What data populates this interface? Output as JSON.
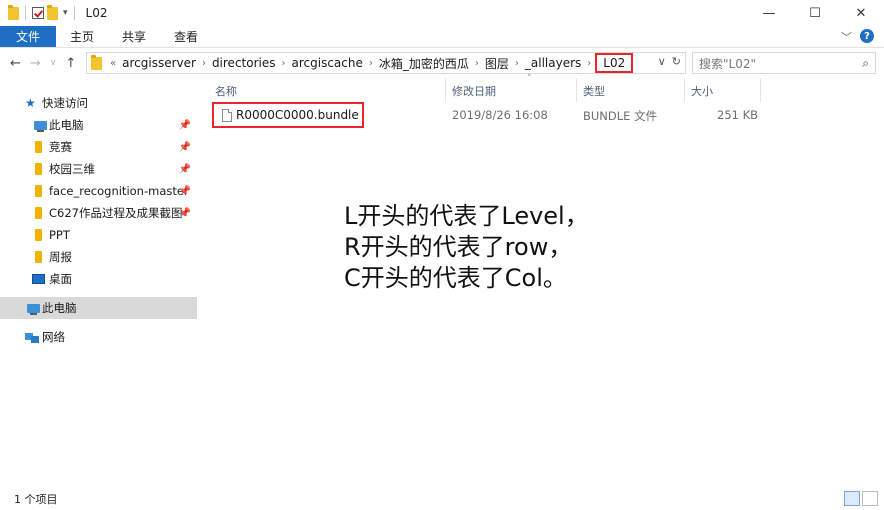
{
  "window": {
    "title": "L02",
    "controls": {
      "minimize": "—",
      "maximize": "☐",
      "close": "✕"
    }
  },
  "ribbon": {
    "tabs": [
      "文件",
      "主页",
      "共享",
      "查看"
    ]
  },
  "address": {
    "crumbs": [
      "arcgisserver",
      "directories",
      "arcgiscache",
      "冰箱_加密的西瓜",
      "图层",
      "_alllayers"
    ],
    "current": "L02",
    "prefix": "«"
  },
  "search": {
    "placeholder": "搜索\"L02\""
  },
  "nav_pane": {
    "items": [
      {
        "label": "快速访问",
        "icon": "star-icon"
      },
      {
        "label": "此电脑",
        "icon": "computer-icon",
        "pinned": true
      },
      {
        "label": "竞赛",
        "icon": "folder-icon",
        "pinned": true
      },
      {
        "label": "校园三维",
        "icon": "folder-icon",
        "pinned": true
      },
      {
        "label": "face_recognition-master",
        "icon": "folder-icon",
        "pinned": true
      },
      {
        "label": "C627作品过程及成果截图",
        "icon": "folder-icon",
        "pinned": true
      },
      {
        "label": "PPT",
        "icon": "folder-icon"
      },
      {
        "label": "周报",
        "icon": "folder-icon"
      },
      {
        "label": "桌面",
        "icon": "desktop-icon"
      },
      {
        "label": "此电脑",
        "icon": "computer-icon",
        "selected": true
      },
      {
        "label": "网络",
        "icon": "network-icon"
      }
    ]
  },
  "columns": [
    "名称",
    "修改日期",
    "类型",
    "大小"
  ],
  "files": [
    {
      "name": "R0000C0000.bundle",
      "modified": "2019/8/26 16:08",
      "type": "BUNDLE 文件",
      "size": "251 KB"
    }
  ],
  "annotation": {
    "lines": [
      "L开头的代表了Level，",
      "R开头的代表了row，",
      "C开头的代表了Col。"
    ]
  },
  "status": {
    "count": "1 个项目"
  },
  "colors": {
    "accent": "#1e6fc4",
    "highlight_box": "#e8262c",
    "selection": "#d9d9d9"
  }
}
